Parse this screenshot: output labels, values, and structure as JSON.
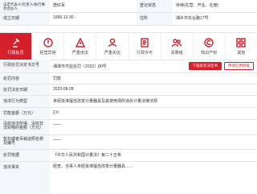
{
  "header": {
    "rep_label": "法定代表人/负责人/执行事务合伙人",
    "rep_value": "唐红军",
    "status_label": "登记状态",
    "status_value": "存续(在营、开业、在册)",
    "date_label": "成立日期",
    "date_value": "1996-12-30",
    "addr_label": "住所",
    "addr_value": "湘乡市东台路17号"
  },
  "tabs": [
    {
      "label": "行政处罚",
      "icon": "gavel-icon",
      "active": true
    },
    {
      "label": "经营异常",
      "icon": "alert-icon",
      "active": false
    },
    {
      "label": "严重违法",
      "icon": "warning-icon",
      "active": false
    },
    {
      "label": "严重失信",
      "icon": "person-icon",
      "active": false
    },
    {
      "label": "行政许可",
      "icon": "document-icon",
      "active": false
    },
    {
      "label": "清算组",
      "icon": "group-icon",
      "active": false
    },
    {
      "label": "知识产权",
      "icon": "copyright-icon",
      "active": false
    },
    {
      "label": "其他",
      "icon": "more-icon",
      "active": false
    }
  ],
  "record": {
    "doc_no_label": "行政处罚决定书文号",
    "doc_no_value": "湘潭市市监处罚〔2023〕80号",
    "btn_download": "下载处罚决定书",
    "btn_apply": "申请信用修复",
    "content_label": "处罚内容",
    "content_value": "罚款",
    "date_label": "处罚决定日期",
    "date_value": "2023-08-28",
    "fact_label": "违法行为类型",
    "fact_value": "未经批准擅自改变计量器具及其使用场所违反计量法律法规",
    "fine_label": "罚款金额（万元）",
    "fine_value": "2.0",
    "confiscate_label": "没收违法所得、没收非法财物的金额（万元）",
    "confiscate_value": "——",
    "licence_label": "暂扣或者吊销证照名称及编号",
    "licence_value": "——",
    "basis_label": "处罚依据",
    "basis_value": "《中华人民共和国计量法》第二十五条",
    "detail_label": "违法事实",
    "detail_value": "经查，当事人未经批准擅自改变计量器具……"
  }
}
